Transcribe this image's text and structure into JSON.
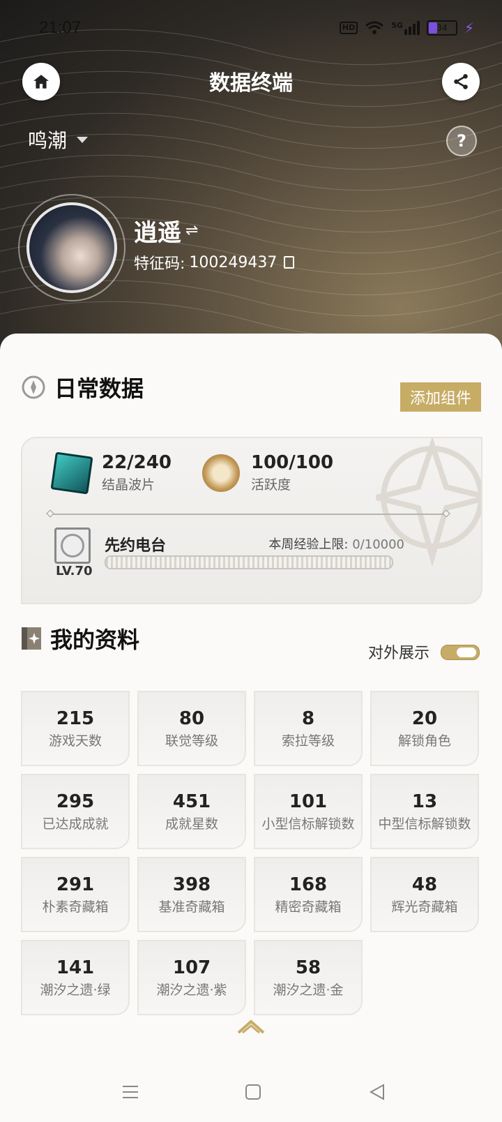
{
  "status": {
    "time": "21:07",
    "hd": "HD",
    "network": "5G",
    "battery": "34"
  },
  "header": {
    "title": "数据终端",
    "home_icon": "home-icon",
    "share_icon": "share-icon",
    "help": "?"
  },
  "game": {
    "name": "鸣潮"
  },
  "profile": {
    "username": "逍遥",
    "switch_symbol": "⇌",
    "uid_label": "特征码:",
    "uid": "100249437"
  },
  "daily": {
    "title": "日常数据",
    "add_button": "添加组件",
    "stats": [
      {
        "value": "22/240",
        "label": "结晶波片"
      },
      {
        "value": "100/100",
        "label": "活跃度"
      }
    ],
    "radio": {
      "title": "先约电台",
      "level": "LV.70",
      "exp_label": "本周经验上限:",
      "exp_value": "0/10000",
      "progress": 0
    }
  },
  "profile_data": {
    "title": "我的资料",
    "public_label": "对外展示",
    "public_on": true,
    "items": [
      {
        "value": "215",
        "label": "游戏天数"
      },
      {
        "value": "80",
        "label": "联觉等级"
      },
      {
        "value": "8",
        "label": "索拉等级"
      },
      {
        "value": "20",
        "label": "解锁角色"
      },
      {
        "value": "295",
        "label": "已达成成就"
      },
      {
        "value": "451",
        "label": "成就星数"
      },
      {
        "value": "101",
        "label": "小型信标解锁数"
      },
      {
        "value": "13",
        "label": "中型信标解锁数"
      },
      {
        "value": "291",
        "label": "朴素奇藏箱"
      },
      {
        "value": "398",
        "label": "基准奇藏箱"
      },
      {
        "value": "168",
        "label": "精密奇藏箱"
      },
      {
        "value": "48",
        "label": "辉光奇藏箱"
      },
      {
        "value": "141",
        "label": "潮汐之遗·绿"
      },
      {
        "value": "107",
        "label": "潮汐之遗·紫"
      },
      {
        "value": "58",
        "label": "潮汐之遗·金"
      }
    ]
  },
  "colors": {
    "accent": "#c7ac66",
    "battery": "#7b4fe0"
  }
}
